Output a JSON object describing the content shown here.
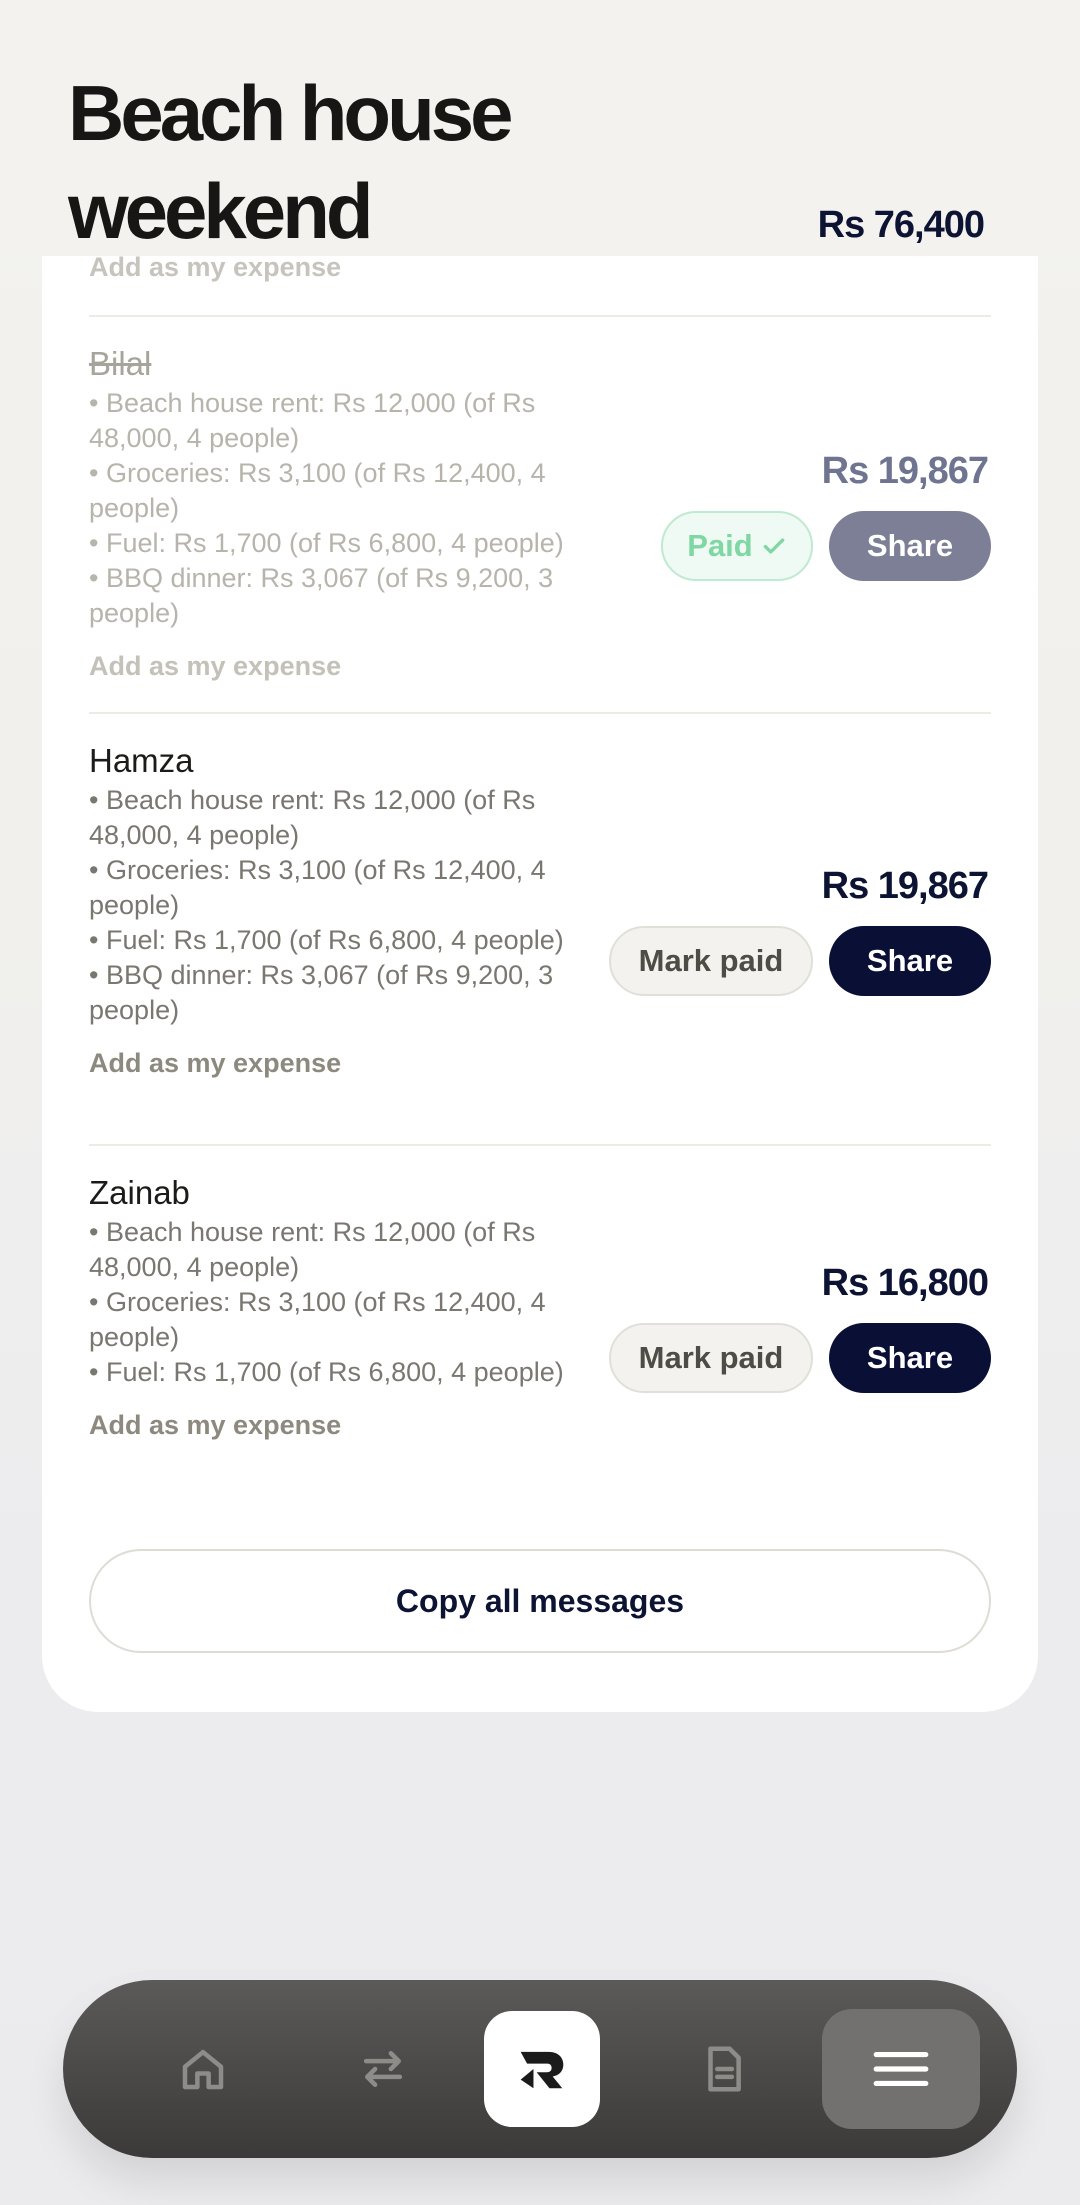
{
  "header": {
    "title": "Beach house weekend",
    "total": "Rs 76,400"
  },
  "peek_link": "Add as my expense",
  "people": [
    {
      "name": "Bilal",
      "lines": [
        "• Beach house rent: Rs 12,000 (of Rs 48,000, 4 people)",
        "• Groceries: Rs 3,100 (of Rs 12,400, 4 people)",
        "• Fuel: Rs 1,700 (of Rs 6,800, 4 people)",
        "• BBQ dinner: Rs 3,067 (of Rs 9,200, 3 people)"
      ],
      "add_link": "Add as my expense",
      "amount": "Rs 19,867",
      "status_label": "Paid",
      "share_label": "Share"
    },
    {
      "name": "Hamza",
      "lines": [
        "• Beach house rent: Rs 12,000 (of Rs 48,000, 4 people)",
        "• Groceries: Rs 3,100 (of Rs 12,400, 4 people)",
        "• Fuel: Rs 1,700 (of Rs 6,800, 4 people)",
        "• BBQ dinner: Rs 3,067 (of Rs 9,200, 3 people)"
      ],
      "add_link": "Add as my expense",
      "amount": "Rs 19,867",
      "status_label": "Mark paid",
      "share_label": "Share"
    },
    {
      "name": "Zainab",
      "lines": [
        "• Beach house rent: Rs 12,000 (of Rs 48,000, 4 people)",
        "• Groceries: Rs 3,100 (of Rs 12,400, 4 people)",
        "• Fuel: Rs 1,700 (of Rs 6,800, 4 people)"
      ],
      "add_link": "Add as my expense",
      "amount": "Rs 16,800",
      "status_label": "Mark paid",
      "share_label": "Share"
    }
  ],
  "copy_all_label": "Copy all messages",
  "nav": {
    "items": [
      "home-icon",
      "transfer-icon",
      "app-logo",
      "document-icon",
      "menu-icon"
    ],
    "active": "menu-icon"
  },
  "colors": {
    "accent": "#0a1035",
    "paid_green": "#7fd7a3",
    "background": "#f3f2ee"
  }
}
